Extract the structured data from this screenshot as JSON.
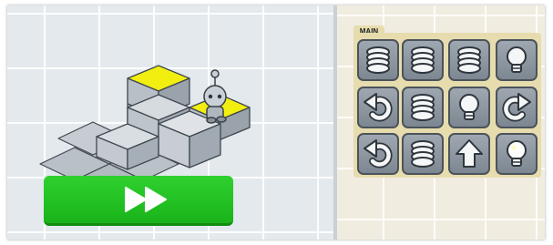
{
  "program": {
    "label": "MAIN",
    "commands": [
      [
        "spring",
        "spring",
        "spring",
        "light"
      ],
      [
        "turn-left",
        "spring",
        "light",
        "turn-right"
      ],
      [
        "turn-left",
        "spring",
        "forward",
        "light-on"
      ]
    ]
  },
  "game": {
    "go_button_icon": "fast-forward-icon",
    "colors": {
      "go_button": "#22c322",
      "lit_tile": "#f4f000",
      "block": "#c9ced3",
      "panel": "#e6dcae",
      "slot": "#8c959e"
    }
  }
}
